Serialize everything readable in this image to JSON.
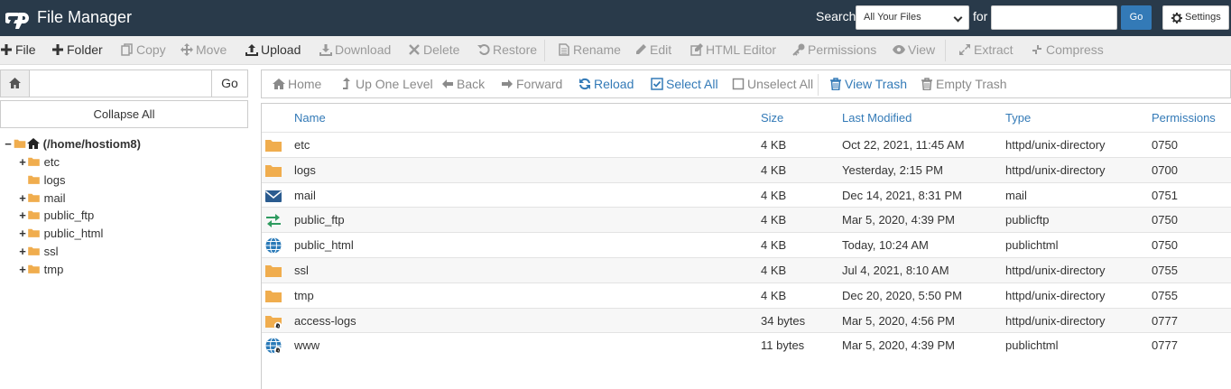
{
  "header": {
    "title": "File Manager",
    "search_label": "Search",
    "search_scope": "All Your Files",
    "for_label": "for",
    "search_value": "",
    "go_label": "Go",
    "settings_label": "Settings"
  },
  "toolbar": [
    {
      "id": "file",
      "label": "File",
      "icon": "plus-icon",
      "enabled": true
    },
    {
      "id": "folder",
      "label": "Folder",
      "icon": "plus-icon",
      "enabled": true
    },
    {
      "id": "copy",
      "label": "Copy",
      "icon": "copy-icon",
      "enabled": false
    },
    {
      "id": "move",
      "label": "Move",
      "icon": "move-icon",
      "enabled": false
    },
    {
      "id": "upload",
      "label": "Upload",
      "icon": "upload-icon",
      "enabled": true
    },
    {
      "id": "download",
      "label": "Download",
      "icon": "download-icon",
      "enabled": false
    },
    {
      "id": "delete",
      "label": "Delete",
      "icon": "times-icon",
      "enabled": false
    },
    {
      "id": "restore",
      "label": "Restore",
      "icon": "undo-icon",
      "enabled": false
    },
    {
      "id": "rename",
      "label": "Rename",
      "icon": "file-icon",
      "enabled": false
    },
    {
      "id": "edit",
      "label": "Edit",
      "icon": "pencil-icon",
      "enabled": false
    },
    {
      "id": "html-editor",
      "label": "HTML Editor",
      "icon": "edit-icon",
      "enabled": false
    },
    {
      "id": "permissions",
      "label": "Permissions",
      "icon": "key-icon",
      "enabled": false
    },
    {
      "id": "view",
      "label": "View",
      "icon": "eye-icon",
      "enabled": false
    },
    {
      "id": "extract",
      "label": "Extract",
      "icon": "expand-icon",
      "enabled": false
    },
    {
      "id": "compress",
      "label": "Compress",
      "icon": "compress-icon",
      "enabled": false
    }
  ],
  "left": {
    "path_value": "",
    "go_label": "Go",
    "collapse_label": "Collapse All",
    "tree": {
      "root": "(/home/hostiom8)",
      "children": [
        {
          "name": "etc",
          "expandable": true
        },
        {
          "name": "logs",
          "expandable": false
        },
        {
          "name": "mail",
          "expandable": true
        },
        {
          "name": "public_ftp",
          "expandable": true
        },
        {
          "name": "public_html",
          "expandable": true
        },
        {
          "name": "ssl",
          "expandable": true
        },
        {
          "name": "tmp",
          "expandable": true
        }
      ]
    }
  },
  "nav": [
    {
      "id": "home",
      "label": "Home",
      "icon": "home-icon",
      "active": false
    },
    {
      "id": "up-one-level",
      "label": "Up One Level",
      "icon": "level-up-icon",
      "active": false
    },
    {
      "id": "back",
      "label": "Back",
      "icon": "arrow-left-icon",
      "active": false
    },
    {
      "id": "forward",
      "label": "Forward",
      "icon": "arrow-right-icon",
      "active": false
    },
    {
      "id": "reload",
      "label": "Reload",
      "icon": "refresh-icon",
      "active": true
    },
    {
      "id": "select-all",
      "label": "Select All",
      "icon": "checkbox-checked-icon",
      "active": true
    },
    {
      "id": "unselect-all",
      "label": "Unselect All",
      "icon": "checkbox-empty-icon",
      "active": false
    },
    {
      "id": "view-trash",
      "label": "View Trash",
      "icon": "trash-icon",
      "active": true
    },
    {
      "id": "empty-trash",
      "label": "Empty Trash",
      "icon": "trash-icon",
      "active": false
    }
  ],
  "table": {
    "columns": [
      "Name",
      "Size",
      "Last Modified",
      "Type",
      "Permissions"
    ],
    "rows": [
      {
        "name": "etc",
        "size": "4 KB",
        "modified": "Oct 22, 2021, 11:45 AM",
        "type": "httpd/unix-directory",
        "perms": "0750",
        "icon": "folder-icon"
      },
      {
        "name": "logs",
        "size": "4 KB",
        "modified": "Yesterday, 2:15 PM",
        "type": "httpd/unix-directory",
        "perms": "0700",
        "icon": "folder-icon"
      },
      {
        "name": "mail",
        "size": "4 KB",
        "modified": "Dec 14, 2021, 8:31 PM",
        "type": "mail",
        "perms": "0751",
        "icon": "envelope-icon"
      },
      {
        "name": "public_ftp",
        "size": "4 KB",
        "modified": "Mar 5, 2020, 4:39 PM",
        "type": "publicftp",
        "perms": "0750",
        "icon": "exchange-icon"
      },
      {
        "name": "public_html",
        "size": "4 KB",
        "modified": "Today, 10:24 AM",
        "type": "publichtml",
        "perms": "0750",
        "icon": "globe-icon"
      },
      {
        "name": "ssl",
        "size": "4 KB",
        "modified": "Jul 4, 2021, 8:10 AM",
        "type": "httpd/unix-directory",
        "perms": "0755",
        "icon": "folder-icon"
      },
      {
        "name": "tmp",
        "size": "4 KB",
        "modified": "Dec 20, 2020, 5:50 PM",
        "type": "httpd/unix-directory",
        "perms": "0755",
        "icon": "folder-icon"
      },
      {
        "name": "access-logs",
        "size": "34 bytes",
        "modified": "Mar 5, 2020, 4:56 PM",
        "type": "httpd/unix-directory",
        "perms": "0777",
        "icon": "folder-link-icon"
      },
      {
        "name": "www",
        "size": "11 bytes",
        "modified": "Mar 5, 2020, 4:39 PM",
        "type": "publichtml",
        "perms": "0777",
        "icon": "globe-link-icon"
      }
    ]
  },
  "colors": {
    "header_bg": "#293a4a",
    "accent": "#337ab7",
    "folder": "#f0ad4e"
  }
}
